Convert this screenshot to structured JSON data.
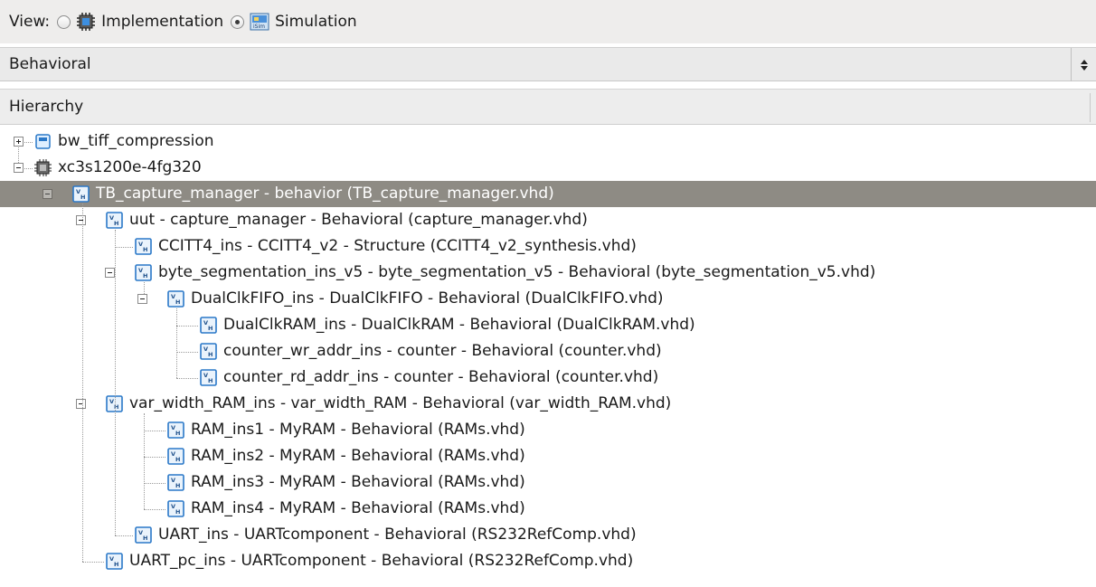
{
  "view": {
    "label": "View:",
    "options": [
      {
        "label": "Implementation",
        "selected": false,
        "icon": "implementation-chip-icon"
      },
      {
        "label": "Simulation",
        "selected": true,
        "icon": "isim-simulation-icon"
      }
    ]
  },
  "combo": {
    "value": "Behavioral"
  },
  "hierarchy": {
    "header": "Hierarchy"
  },
  "tree": {
    "rows": [
      {
        "label": "bw_tiff_compression",
        "icon": "project-icon",
        "expander": "plus"
      },
      {
        "label": "xc3s1200e-4fg320",
        "icon": "fpga-device-icon",
        "expander": "minus"
      },
      {
        "label": "TB_capture_manager - behavior (TB_capture_manager.vhd)",
        "icon": "vhdl-file-icon",
        "expander": "minus",
        "selected": true
      },
      {
        "label": "uut - capture_manager - Behavioral (capture_manager.vhd)",
        "icon": "vhdl-file-icon",
        "expander": "minus"
      },
      {
        "label": "CCITT4_ins - CCITT4_v2 - Structure (CCITT4_v2_synthesis.vhd)",
        "icon": "vhdl-file-icon"
      },
      {
        "label": "byte_segmentation_ins_v5 - byte_segmentation_v5 - Behavioral (byte_segmentation_v5.vhd)",
        "icon": "vhdl-file-icon",
        "expander": "minus"
      },
      {
        "label": "DualClkFIFO_ins - DualClkFIFO - Behavioral (DualClkFIFO.vhd)",
        "icon": "vhdl-file-icon",
        "expander": "minus"
      },
      {
        "label": "DualClkRAM_ins - DualClkRAM - Behavioral (DualClkRAM.vhd)",
        "icon": "vhdl-file-icon"
      },
      {
        "label": "counter_wr_addr_ins - counter - Behavioral (counter.vhd)",
        "icon": "vhdl-file-icon"
      },
      {
        "label": "counter_rd_addr_ins - counter - Behavioral (counter.vhd)",
        "icon": "vhdl-file-icon"
      },
      {
        "label": "var_width_RAM_ins - var_width_RAM - Behavioral (var_width_RAM.vhd)",
        "icon": "vhdl-file-icon",
        "expander": "minus"
      },
      {
        "label": "RAM_ins1 - MyRAM - Behavioral (RAMs.vhd)",
        "icon": "vhdl-file-icon"
      },
      {
        "label": "RAM_ins2 - MyRAM - Behavioral (RAMs.vhd)",
        "icon": "vhdl-file-icon"
      },
      {
        "label": "RAM_ins3 - MyRAM - Behavioral (RAMs.vhd)",
        "icon": "vhdl-file-icon"
      },
      {
        "label": "RAM_ins4 - MyRAM - Behavioral (RAMs.vhd)",
        "icon": "vhdl-file-icon"
      },
      {
        "label": "UART_ins - UARTcomponent - Behavioral (RS232RefComp.vhd)",
        "icon": "vhdl-file-icon"
      },
      {
        "label": "UART_pc_ins - UARTcomponent - Behavioral (RS232RefComp.vhd)",
        "icon": "vhdl-file-icon"
      }
    ]
  },
  "colors": {
    "selection": "#8e8b84",
    "toolbar": "#eeedec",
    "vhdl_icon": "#2a78c8"
  }
}
